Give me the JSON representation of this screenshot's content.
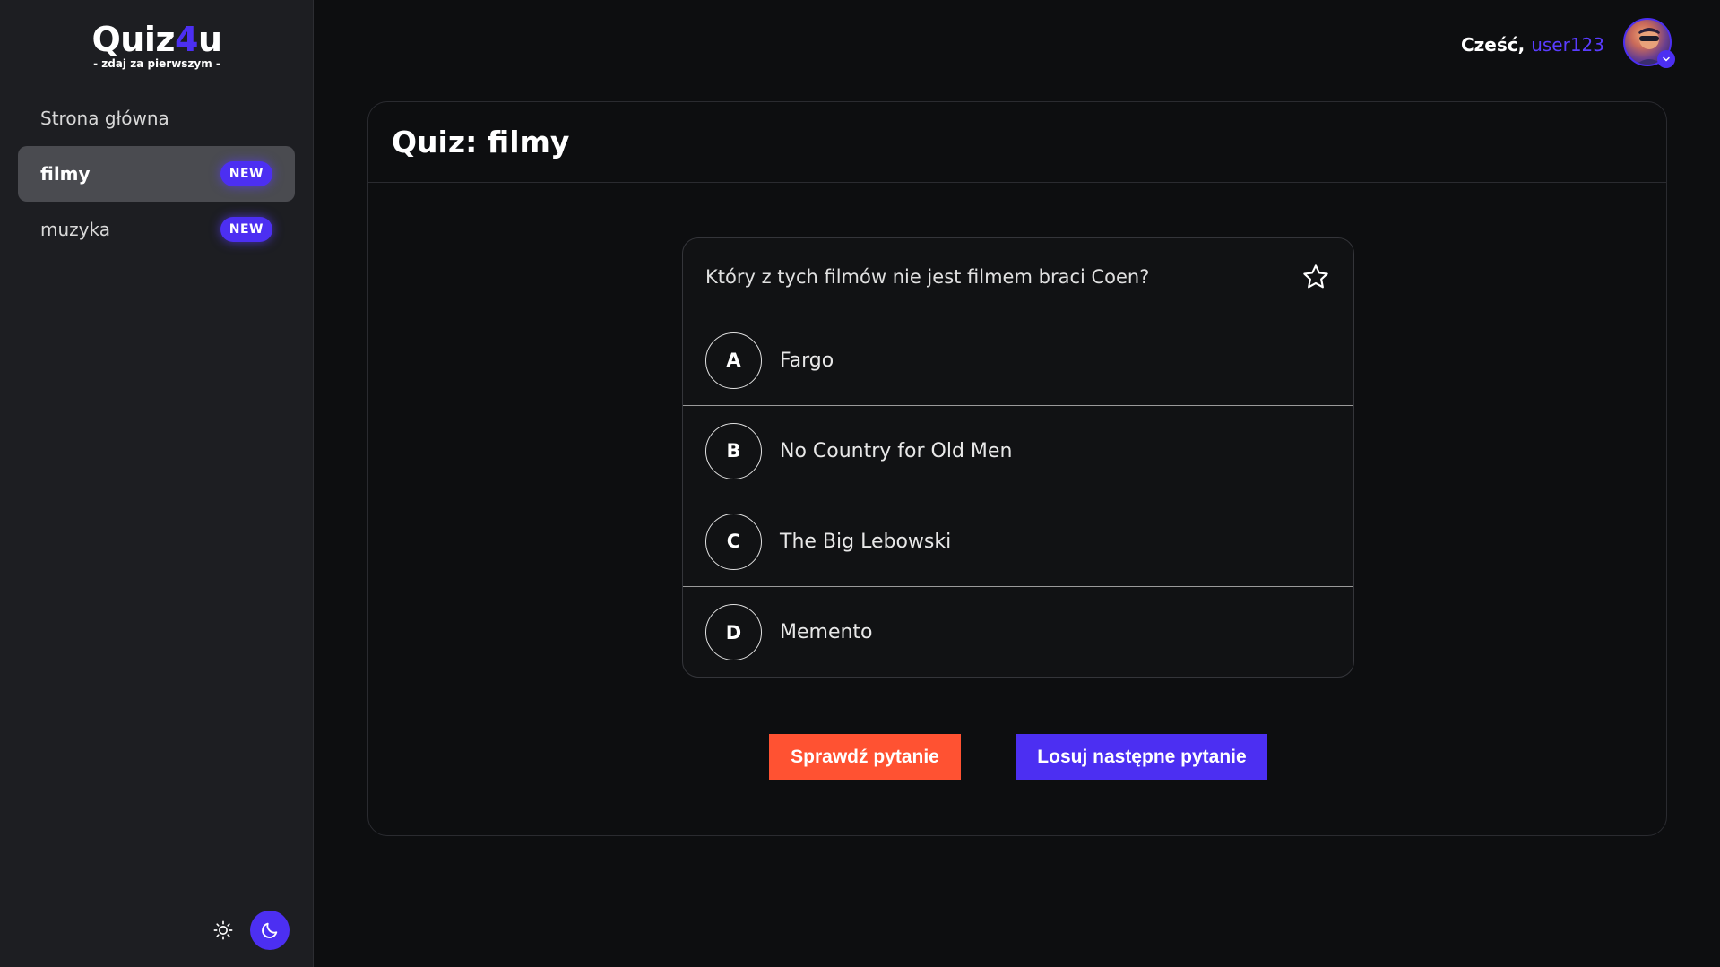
{
  "brand": {
    "name_part1": "Quiz",
    "name_accent": "4",
    "name_part2": "u",
    "tagline": "- zdaj za pierwszym -"
  },
  "sidebar": {
    "items": [
      {
        "label": "Strona główna",
        "badge": "",
        "active": false
      },
      {
        "label": "filmy",
        "badge": "NEW",
        "active": true
      },
      {
        "label": "muzyka",
        "badge": "NEW",
        "active": false
      }
    ],
    "theme_icons": [
      "sun-icon",
      "moon-icon"
    ]
  },
  "header": {
    "greeting": "Cześć,",
    "username": "user123"
  },
  "quiz": {
    "title": "Quiz: filmy",
    "question": "Który z tych filmów nie jest filmem braci Coen?",
    "answers": [
      {
        "letter": "A",
        "text": "Fargo"
      },
      {
        "letter": "B",
        "text": "No Country for Old Men"
      },
      {
        "letter": "C",
        "text": "The Big Lebowski"
      },
      {
        "letter": "D",
        "text": "Memento"
      }
    ],
    "check_button": "Sprawdź pytanie",
    "next_button": "Losuj następne pytanie"
  },
  "colors": {
    "accent": "#4c2ff2",
    "check": "#ff5232",
    "sidebar_bg": "#1d1e22",
    "page_bg": "#0d0e10"
  }
}
